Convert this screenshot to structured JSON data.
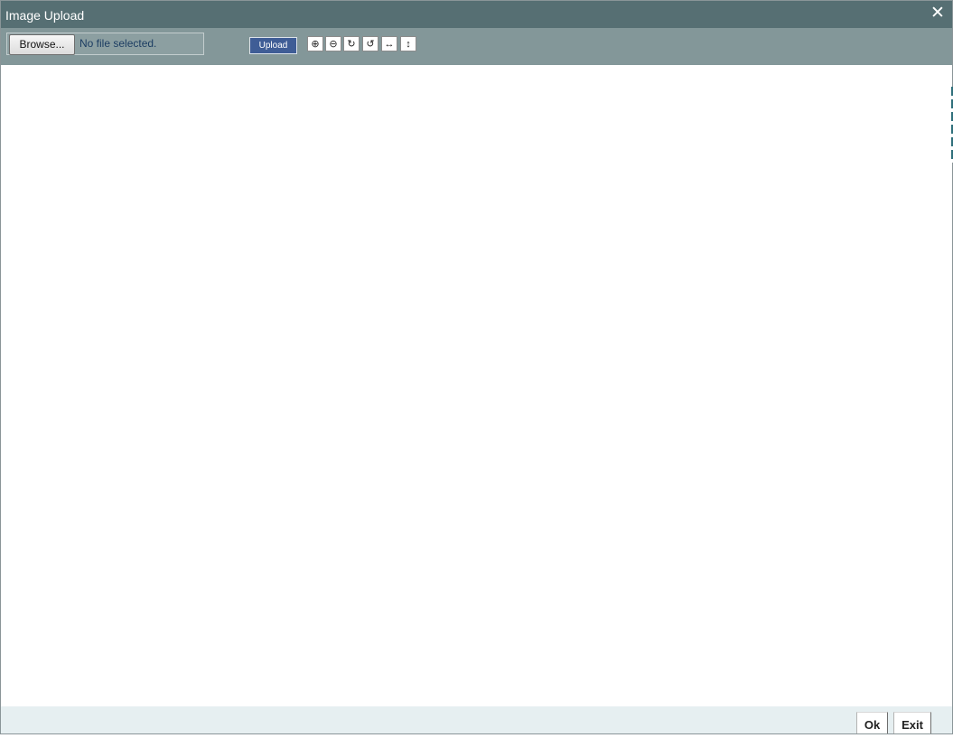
{
  "window": {
    "title": "Image Upload",
    "close_symbol": "✕"
  },
  "toolbar": {
    "browse_label": "Browse...",
    "file_status": "No file selected.",
    "upload_label": "Upload",
    "tools": [
      {
        "name": "zoom-in-icon",
        "glyph": "⊕"
      },
      {
        "name": "zoom-out-icon",
        "glyph": "⊖"
      },
      {
        "name": "rotate-right-icon",
        "glyph": "↻"
      },
      {
        "name": "rotate-left-icon",
        "glyph": "↺"
      },
      {
        "name": "flip-horizontal-icon",
        "glyph": "↔"
      },
      {
        "name": "flip-vertical-icon",
        "glyph": "↕"
      }
    ]
  },
  "footer": {
    "ok_label": "Ok",
    "exit_label": "Exit"
  },
  "colors": {
    "titlebar": "#566f73",
    "toolbar": "#839799",
    "upload_button": "#3f5d96",
    "footer": "#e6eff1"
  }
}
